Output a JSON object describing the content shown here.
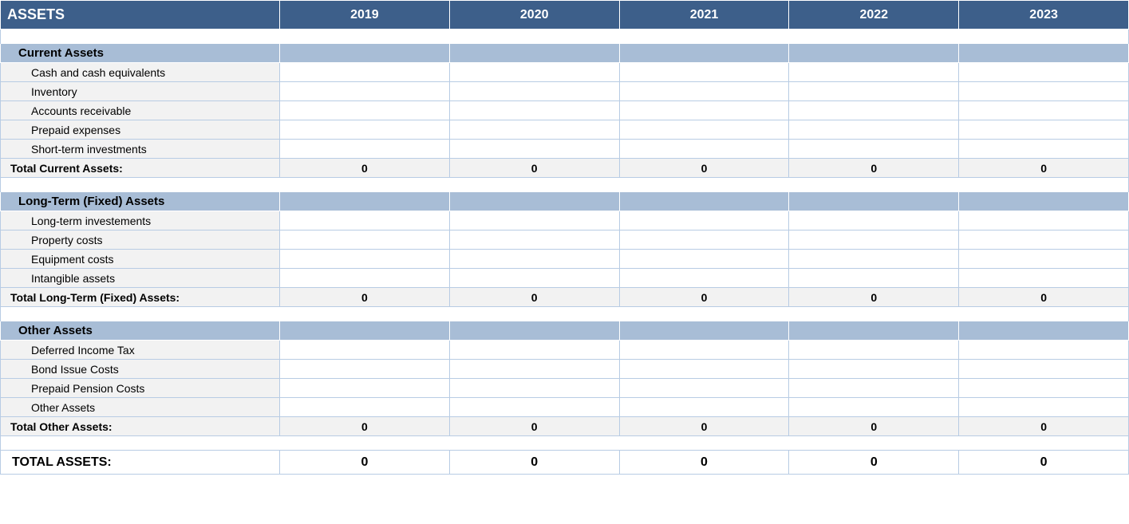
{
  "header": {
    "title": "ASSETS",
    "years": [
      "2019",
      "2020",
      "2021",
      "2022",
      "2023"
    ]
  },
  "sections": [
    {
      "title": "Current Assets",
      "items": [
        {
          "label": "Cash and cash equivalents",
          "values": [
            "",
            "",
            "",
            "",
            ""
          ]
        },
        {
          "label": "Inventory",
          "values": [
            "",
            "",
            "",
            "",
            ""
          ]
        },
        {
          "label": "Accounts receivable",
          "values": [
            "",
            "",
            "",
            "",
            ""
          ]
        },
        {
          "label": "Prepaid expenses",
          "values": [
            "",
            "",
            "",
            "",
            ""
          ]
        },
        {
          "label": "Short-term investments",
          "values": [
            "",
            "",
            "",
            "",
            ""
          ]
        }
      ],
      "subtotal": {
        "label": "Total Current Assets:",
        "values": [
          "0",
          "0",
          "0",
          "0",
          "0"
        ]
      }
    },
    {
      "title": "Long-Term (Fixed) Assets",
      "items": [
        {
          "label": "Long-term investements",
          "values": [
            "",
            "",
            "",
            "",
            ""
          ]
        },
        {
          "label": "Property costs",
          "values": [
            "",
            "",
            "",
            "",
            ""
          ]
        },
        {
          "label": "Equipment costs",
          "values": [
            "",
            "",
            "",
            "",
            ""
          ]
        },
        {
          "label": "Intangible assets",
          "values": [
            "",
            "",
            "",
            "",
            ""
          ]
        }
      ],
      "subtotal": {
        "label": "Total Long-Term (Fixed) Assets:",
        "values": [
          "0",
          "0",
          "0",
          "0",
          "0"
        ]
      }
    },
    {
      "title": "Other Assets",
      "items": [
        {
          "label": "Deferred Income Tax",
          "values": [
            "",
            "",
            "",
            "",
            ""
          ]
        },
        {
          "label": "Bond Issue Costs",
          "values": [
            "",
            "",
            "",
            "",
            ""
          ]
        },
        {
          "label": "Prepaid Pension Costs",
          "values": [
            "",
            "",
            "",
            "",
            ""
          ]
        },
        {
          "label": "Other Assets",
          "values": [
            "",
            "",
            "",
            "",
            ""
          ]
        }
      ],
      "subtotal": {
        "label": "Total Other Assets:",
        "values": [
          "0",
          "0",
          "0",
          "0",
          "0"
        ]
      }
    }
  ],
  "grand_total": {
    "label": "TOTAL ASSETS:",
    "values": [
      "0",
      "0",
      "0",
      "0",
      "0"
    ]
  }
}
